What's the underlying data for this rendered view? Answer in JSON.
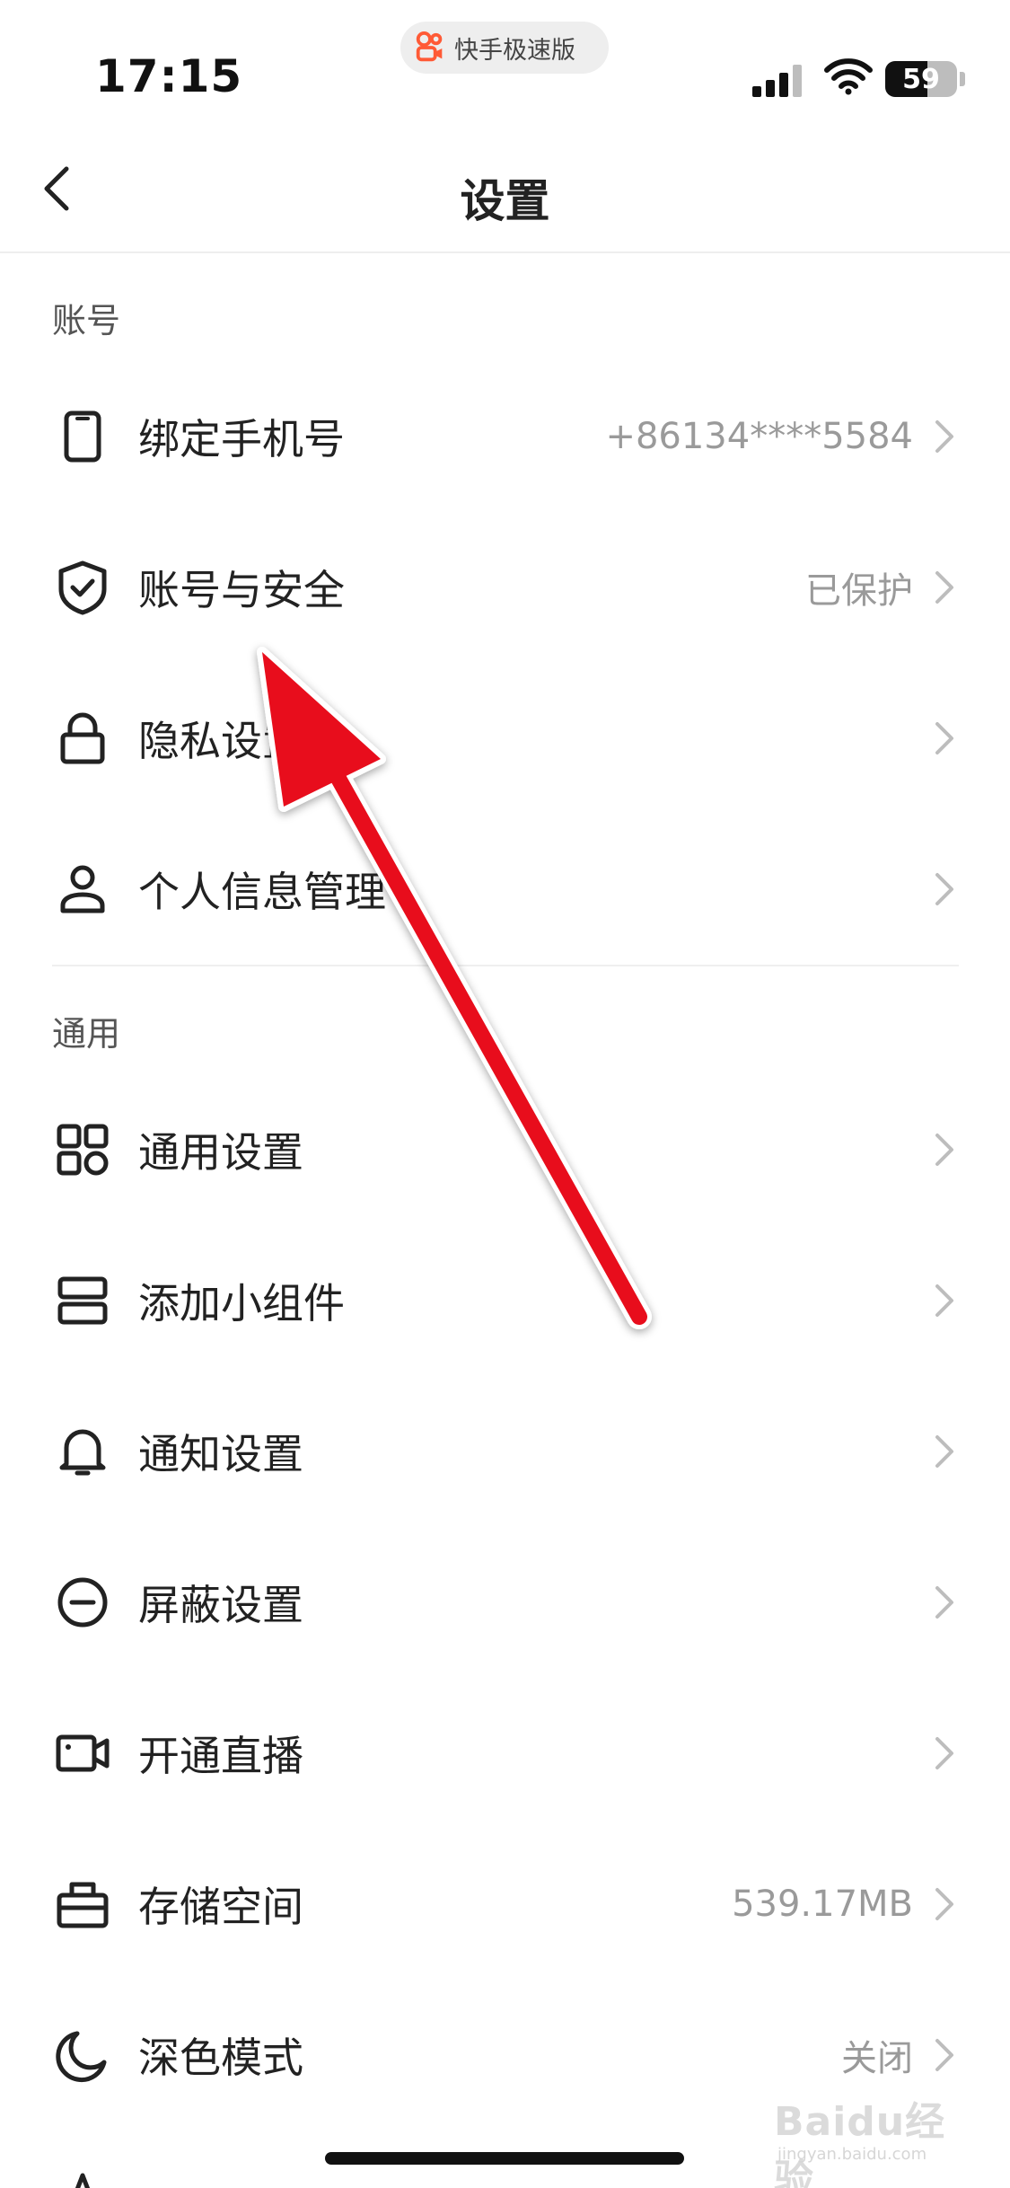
{
  "status_bar": {
    "time": "17:15",
    "app_badge": "快手极速版",
    "battery_level": "59",
    "battery_fraction": 0.59
  },
  "nav": {
    "title": "设置"
  },
  "sections": [
    {
      "header": "账号",
      "items": [
        {
          "icon": "phone-icon",
          "label": "绑定手机号",
          "value": "+86134****5584"
        },
        {
          "icon": "shield-check-icon",
          "label": "账号与安全",
          "value": "已保护"
        },
        {
          "icon": "lock-icon",
          "label": "隐私设置",
          "value": ""
        },
        {
          "icon": "person-icon",
          "label": "个人信息管理",
          "value": ""
        }
      ]
    },
    {
      "header": "通用",
      "items": [
        {
          "icon": "grid-icon",
          "label": "通用设置",
          "value": ""
        },
        {
          "icon": "widget-icon",
          "label": "添加小组件",
          "value": ""
        },
        {
          "icon": "bell-icon",
          "label": "通知设置",
          "value": ""
        },
        {
          "icon": "block-icon",
          "label": "屏蔽设置",
          "value": ""
        },
        {
          "icon": "video-camera-icon",
          "label": "开通直播",
          "value": ""
        },
        {
          "icon": "storage-box-icon",
          "label": "存储空间",
          "value": "539.17MB"
        },
        {
          "icon": "moon-icon",
          "label": "深色模式",
          "value": "关闭"
        }
      ]
    }
  ],
  "watermark": {
    "brand": "Baidu经验",
    "url": "jingyan.baidu.com"
  },
  "colors": {
    "annotation_arrow": "#e8101c",
    "secondary_text": "#9a9a9a",
    "primary_text": "#222222"
  }
}
